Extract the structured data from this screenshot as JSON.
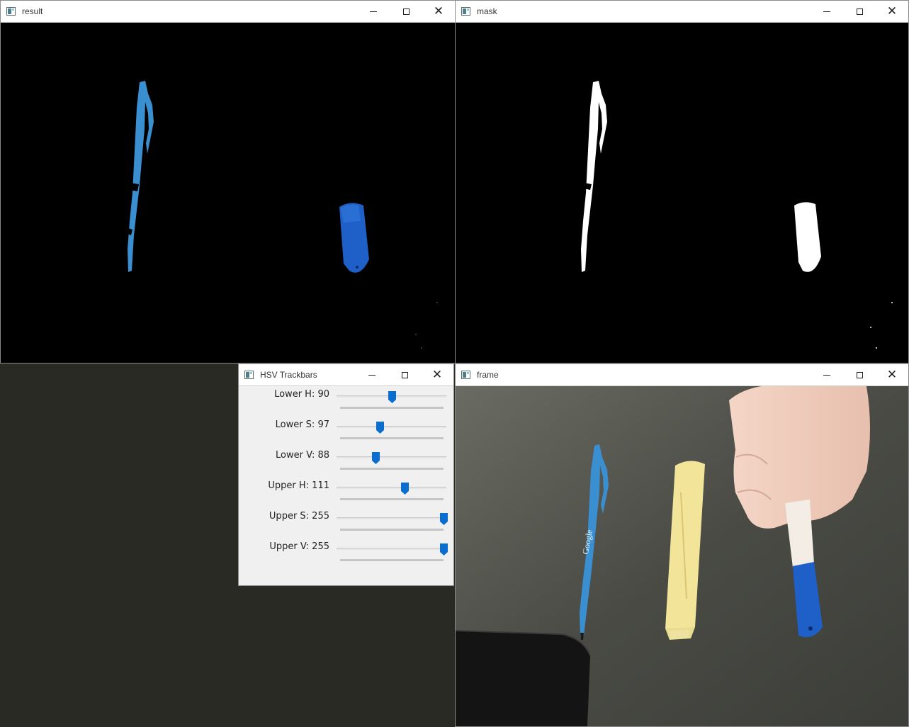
{
  "windows": {
    "result": {
      "title": "result"
    },
    "mask": {
      "title": "mask"
    },
    "trackbars": {
      "title": "HSV Trackbars"
    },
    "frame": {
      "title": "frame"
    }
  },
  "trackbars": [
    {
      "label": "Lower H: 90",
      "value": 90,
      "max": 179
    },
    {
      "label": "Lower S: 97",
      "value": 97,
      "max": 255
    },
    {
      "label": "Lower V: 88",
      "value": 88,
      "max": 255
    },
    {
      "label": "Upper H: 111",
      "value": 111,
      "max": 179
    },
    {
      "label": "Upper S: 255",
      "value": 255,
      "max": 255
    },
    {
      "label": "Upper V: 255",
      "value": 255,
      "max": 255
    }
  ],
  "frame_scene": {
    "pen_text": "Google"
  },
  "colors": {
    "accent": "#0a6ed1",
    "pen_blue": "#3a8fd0",
    "marker_blue": "#1e5fc8",
    "highlighter_yellow": "#f2e59a",
    "table_dark": "#3a3a36"
  },
  "icons": {
    "window": "window-icon",
    "minimize": "minimize-icon",
    "maximize": "maximize-icon",
    "close": "close-icon"
  }
}
